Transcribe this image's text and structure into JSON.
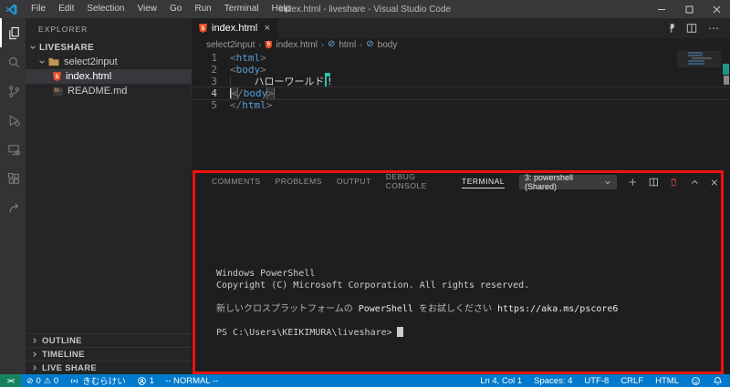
{
  "window": {
    "title": "index.html - liveshare - Visual Studio Code",
    "menu": [
      "File",
      "Edit",
      "Selection",
      "View",
      "Go",
      "Run",
      "Terminal",
      "Help"
    ]
  },
  "activity_bar": {
    "icons": [
      "explorer",
      "search",
      "source-control",
      "run-and-debug",
      "remote-explorer",
      "extensions",
      "live-share"
    ]
  },
  "sidebar": {
    "header": "EXPLORER",
    "root": "LIVESHARE",
    "folder": "select2input",
    "file1": "index.html",
    "file2": "README.md",
    "sections": [
      "OUTLINE",
      "TIMELINE",
      "LIVE SHARE"
    ]
  },
  "editor": {
    "tab": "index.html",
    "breadcrumb": [
      "select2input",
      "index.html",
      "html",
      "body"
    ],
    "code": {
      "n1": "1",
      "n2": "2",
      "n3": "3",
      "n4": "4",
      "n5": "5",
      "l1a": "<",
      "l1b": "html",
      "l1c": ">",
      "l2a": "<",
      "l2b": "body",
      "l2c": ">",
      "l3indent": "    ",
      "l3text": "ハローワールド",
      "l3bang": "!",
      "l4a": "<",
      "l4slash": "/",
      "l4b": "body",
      "l4c": ">",
      "l5a": "</",
      "l5b": "html",
      "l5c": ">"
    }
  },
  "panel": {
    "tabs": [
      "COMMENTS",
      "PROBLEMS",
      "OUTPUT",
      "DEBUG CONSOLE",
      "TERMINAL"
    ],
    "active_tab": "TERMINAL",
    "dropdown": "3: powershell (Shared)",
    "terminal": {
      "line1": "Windows PowerShell",
      "line2": "Copyright (C) Microsoft Corporation. All rights reserved.",
      "line3_pre": "新しいクロスプラットフォームの ",
      "line3_ps": "PowerShell",
      "line3_mid": " をお試しください ",
      "line3_url": "https://aka.ms/pscore6",
      "prompt": "PS C:\\Users\\KEIKIMURA\\liveshare>"
    }
  },
  "status_bar": {
    "remote_glyph": "><",
    "errors": "0",
    "warnings": "0",
    "user": "きむらけい",
    "participants": "1",
    "mode": "-- NORMAL --",
    "ln_col": "Ln 4, Col 1",
    "spaces": "Spaces: 4",
    "encoding": "UTF-8",
    "eol": "CRLF",
    "language": "HTML"
  },
  "colors": {
    "accent": "#007acc",
    "remote_green": "#16825d",
    "annotation_red": "#ee1111",
    "html_icon_orange": "#e44d26",
    "collaborator_cursor": "#26c6ab"
  }
}
